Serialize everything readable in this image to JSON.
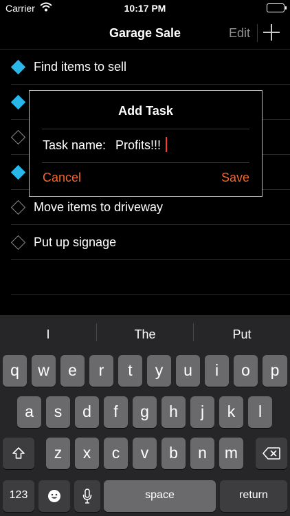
{
  "status_bar": {
    "carrier": "Carrier",
    "time": "10:17 PM"
  },
  "nav": {
    "title": "Garage Sale",
    "edit_label": "Edit",
    "add_icon": "plus-icon"
  },
  "tasks": [
    {
      "label": "Find items to sell",
      "done": true
    },
    {
      "label": "",
      "done": true
    },
    {
      "label": "",
      "done": false
    },
    {
      "label": "",
      "done": true
    },
    {
      "label": "Move items to driveway",
      "done": false
    },
    {
      "label": "Put up signage",
      "done": false
    }
  ],
  "dialog": {
    "title": "Add Task",
    "field_label": "Task name:",
    "field_value": "Profits!!!",
    "cancel_label": "Cancel",
    "save_label": "Save"
  },
  "keyboard": {
    "suggestions": [
      "I",
      "The",
      "Put"
    ],
    "row1": [
      "q",
      "w",
      "e",
      "r",
      "t",
      "y",
      "u",
      "i",
      "o",
      "p"
    ],
    "row2": [
      "a",
      "s",
      "d",
      "f",
      "g",
      "h",
      "j",
      "k",
      "l"
    ],
    "row3": [
      "z",
      "x",
      "c",
      "v",
      "b",
      "n",
      "m"
    ],
    "numbers_label": "123",
    "space_label": "space",
    "return_label": "return"
  },
  "colors": {
    "accent": "#f0672f",
    "done_diamond": "#29b6e8"
  }
}
